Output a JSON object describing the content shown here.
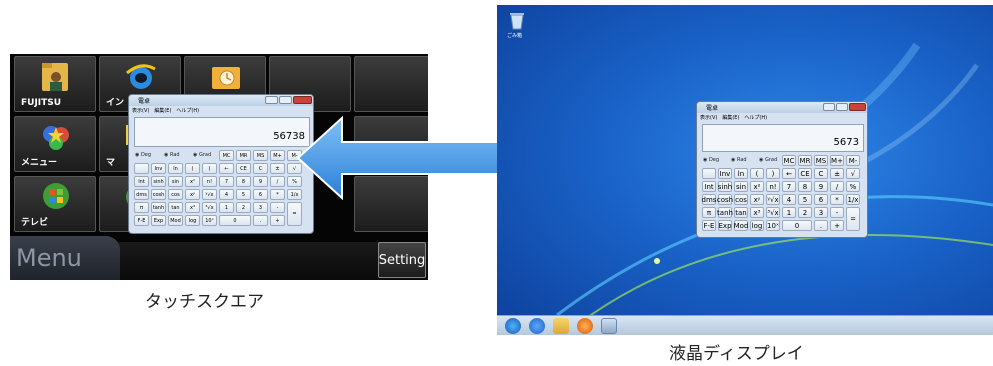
{
  "touch_square": {
    "tiles": [
      {
        "label": "FUJITSU",
        "icon": "fujitsu-folder-icon"
      },
      {
        "label": "イン",
        "icon": "internet-explorer-icon"
      },
      {
        "label": "",
        "icon": "mail-icon"
      },
      {
        "label": "メニュー",
        "icon": "menu-star-icon"
      },
      {
        "label": "マ",
        "icon": "media-icon"
      },
      {
        "label": "テレビ",
        "icon": "windows-tv-icon"
      }
    ],
    "menu_label": "Menu",
    "setting_label": "Setting"
  },
  "calculator": {
    "title": "電卓",
    "menu": [
      "表示(V)",
      "編集(E)",
      "ヘルプ(H)"
    ],
    "display_touch": "56738",
    "display_desktop": "5673",
    "radios": [
      "Deg",
      "Rad",
      "Grad"
    ],
    "memory_keys": [
      "MC",
      "MR",
      "MS",
      "M+",
      "M-"
    ],
    "rows": [
      [
        "",
        "Inv",
        "ln",
        "(",
        ")",
        "←",
        "CE",
        "C",
        "±",
        "√"
      ],
      [
        "Int",
        "sinh",
        "sin",
        "x²",
        "n!",
        "7",
        "8",
        "9",
        "/",
        "%"
      ],
      [
        "dms",
        "cosh",
        "cos",
        "xʸ",
        "ʸ√x",
        "4",
        "5",
        "6",
        "*",
        "1/x"
      ],
      [
        "π",
        "tanh",
        "tan",
        "x³",
        "³√x",
        "1",
        "2",
        "3",
        "-",
        "="
      ],
      [
        "F-E",
        "Exp",
        "Mod",
        "log",
        "10ˣ",
        "0",
        ".",
        "+"
      ]
    ]
  },
  "desktop": {
    "recycle_bin_label": "ごみ箱",
    "taskbar_icons": [
      "start-orb-icon",
      "ie-taskbar-icon",
      "explorer-taskbar-icon",
      "media-player-taskbar-icon",
      "calculator-taskbar-icon"
    ]
  },
  "captions": {
    "left": "タッチスクエア",
    "right": "液晶ディスプレイ"
  },
  "colors": {
    "desktop_blue": "#1a63c9",
    "arrow_blue": "#3b8ee6",
    "close_red": "#c9443a"
  }
}
